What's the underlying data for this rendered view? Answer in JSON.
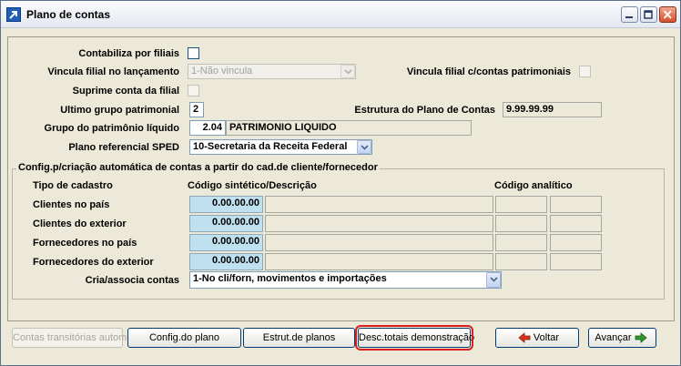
{
  "window": {
    "title": "Plano de contas"
  },
  "form": {
    "contabiliza_label": "Contabiliza por filiais",
    "vincula_label": "Vincula filial no lançamento",
    "vincula_value": "1-Não vincula",
    "vincula_patr_label": "Vincula filial c/contas patrimoniais",
    "suprime_label": "Suprime conta da filial",
    "ultimo_grupo_label": "Ultimo grupo patrimonial",
    "ultimo_grupo_value": "2",
    "estrutura_label": "Estrutura do Plano de Contas",
    "estrutura_value": "9.99.99.99",
    "grupo_pl_label": "Grupo do patrimônio líquido",
    "grupo_pl_code": "2.04",
    "grupo_pl_desc": "PATRIMONIO LIQUIDO",
    "plano_ref_label": "Plano referencial SPED",
    "plano_ref_value": "10-Secretaria da Receita Federal"
  },
  "config": {
    "title": "Config.p/criação automática de contas a partir do cad.de cliente/fornecedor",
    "col_tipo": "Tipo de cadastro",
    "col_sintetico": "Código sintético/Descrição",
    "col_analitico": "Código analítico",
    "rows": [
      {
        "label": "Clientes no país",
        "code": "0.00.00.00"
      },
      {
        "label": "Clientes do exterior",
        "code": "0.00.00.00"
      },
      {
        "label": "Fornecedores no país",
        "code": "0.00.00.00"
      },
      {
        "label": "Fornecedores do exterior",
        "code": "0.00.00.00"
      }
    ],
    "cria_label": "Cria/associa contas",
    "cria_value": "1-No cli/forn, movimentos e importações"
  },
  "buttons": {
    "transitorias": "Contas transitórias autom",
    "config_plano": "Config.do plano",
    "estrut_planos": "Estrut.de planos",
    "desc_totais": "Desc.totais demonstração",
    "voltar": "Voltar",
    "avancar": "Avançar"
  },
  "colors": {
    "highlight": "#d9201c",
    "code_field": "#bfe0ee",
    "voltar_arrow": "#d8341c",
    "avancar_arrow": "#2f9a2a"
  }
}
